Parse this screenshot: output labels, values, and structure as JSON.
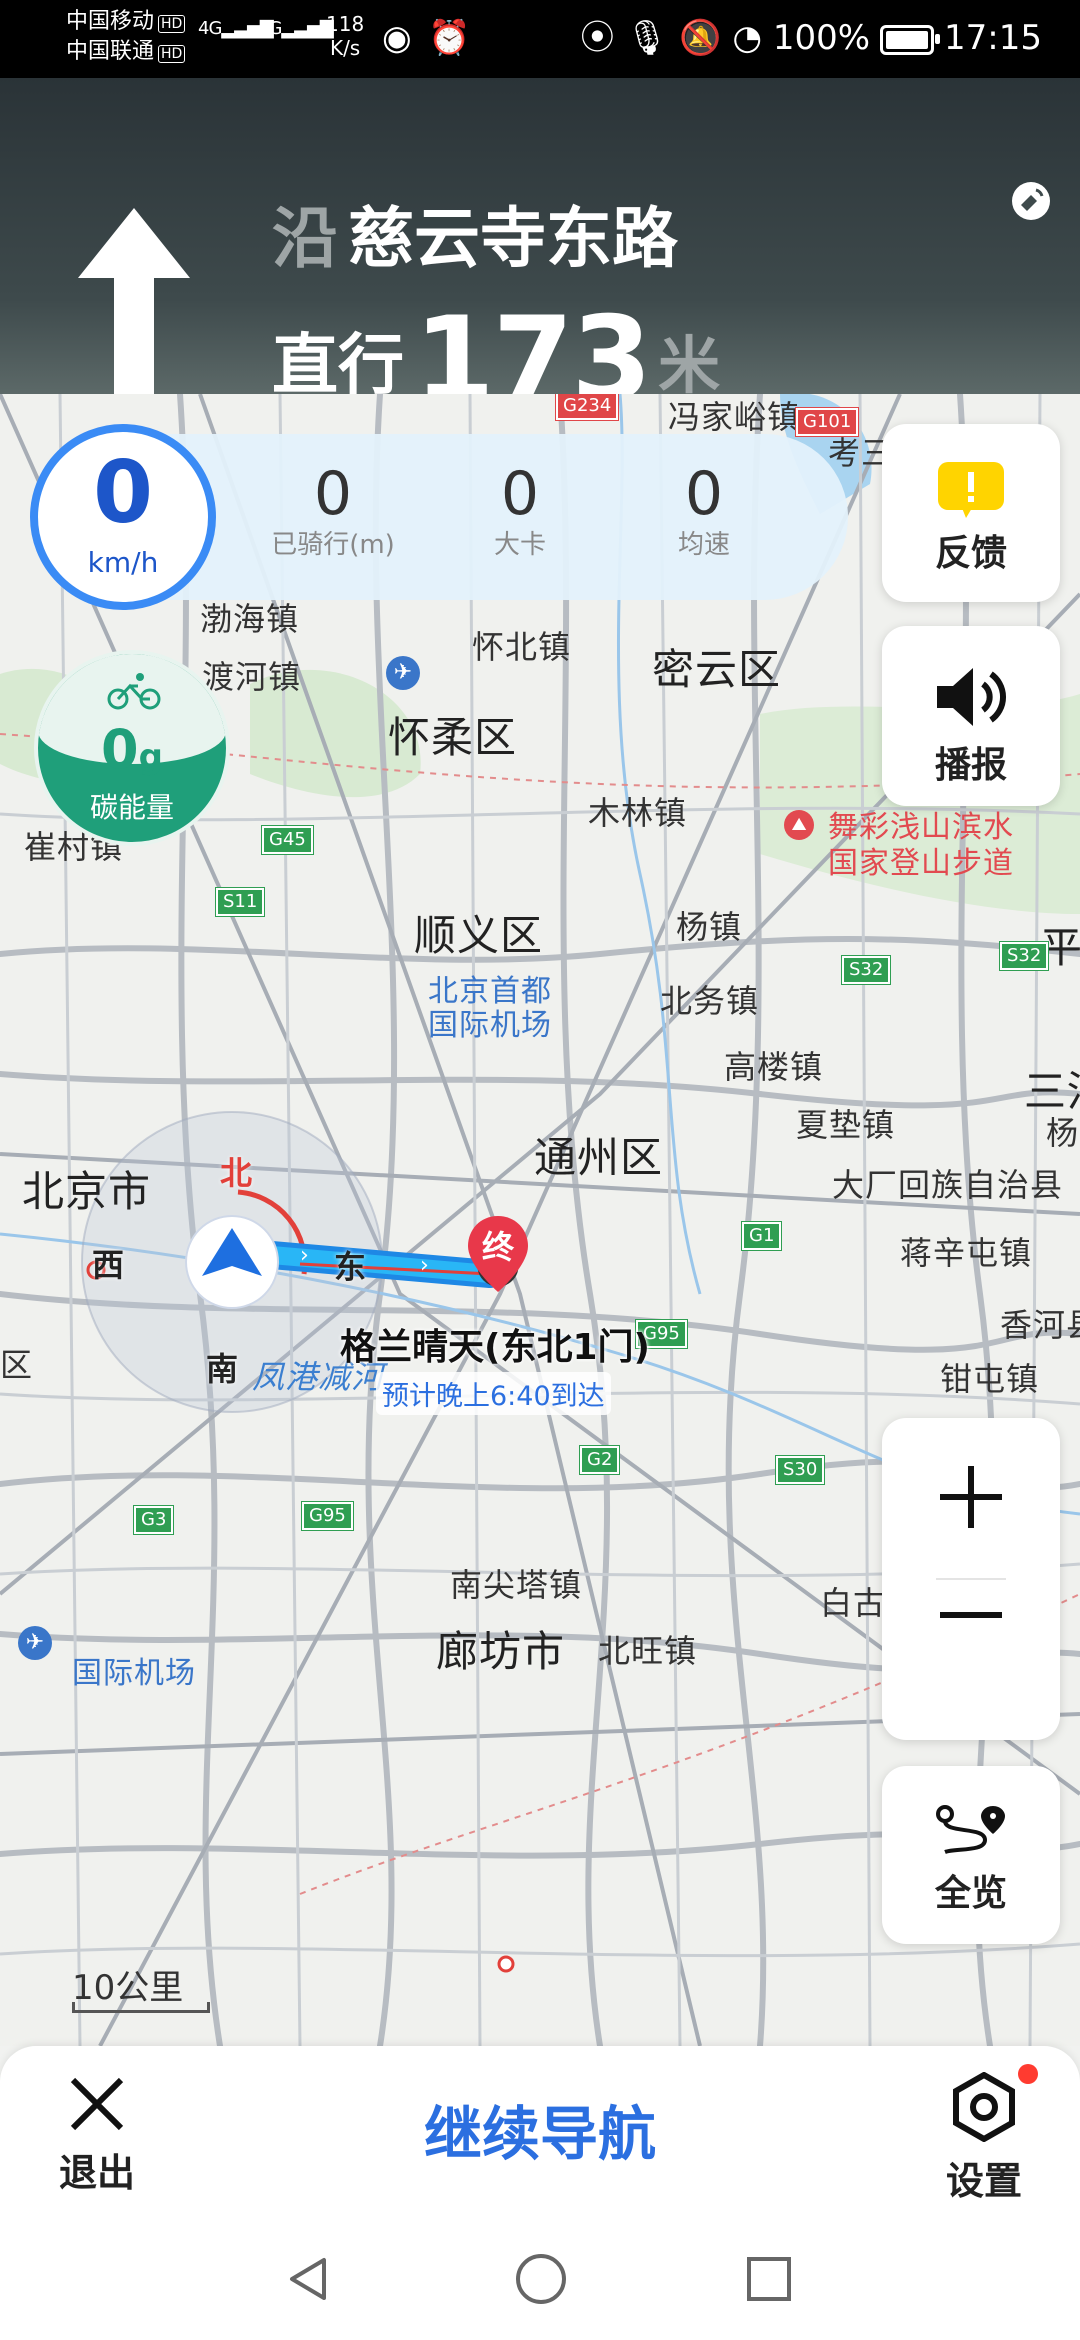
{
  "status_bar": {
    "carrier1": "中国移动",
    "carrier2": "中国联通",
    "hd": "HD",
    "signal1": "4G",
    "signal2": "4G",
    "net_speed_value": "118",
    "net_speed_unit": "K/s",
    "battery": "100%",
    "time": "17:15"
  },
  "nav_header": {
    "along": "沿",
    "street": "慈云寺东路",
    "action": "直行",
    "distance": "173",
    "unit": "米"
  },
  "speed_panel": {
    "speed": "0",
    "speed_unit": "km/h",
    "stats": [
      {
        "value": "0",
        "label": "已骑行(m)"
      },
      {
        "value": "0",
        "label": "大卡"
      },
      {
        "value": "0",
        "label": "均速"
      }
    ]
  },
  "carbon": {
    "value": "0",
    "unit": "g",
    "label": "碳能量"
  },
  "side_buttons": {
    "feedback": "反馈",
    "broadcast": "播报",
    "overview": "全览"
  },
  "map": {
    "labels": {
      "fengjiayu": "冯家峪镇",
      "kaoshan": "考三",
      "bohai": "渤海镇",
      "huaibei": "怀北镇",
      "miyun": "密云区",
      "duhe": "渡河镇",
      "huairou": "怀柔区",
      "mulin": "木林镇",
      "cuicun": "崔村镇",
      "wucai1": "舞彩浅山滨水",
      "wucai2": "国家登山步道",
      "ping": "平",
      "shunyi": "顺义区",
      "yangzhen": "杨镇",
      "airport1": "北京首都",
      "airport2": "国际机场",
      "beiwu": "北务镇",
      "gaolou": "高楼镇",
      "sanhe": "三河",
      "xiadian": "夏垫镇",
      "yang": "杨",
      "tongzhou": "通州区",
      "beijing": "北京市",
      "dachang": "大厂回族自治县",
      "xiangji": "蒋辛屯镇",
      "xianghe": "香河县",
      "qu": "区",
      "fenggang": "凤港减河",
      "qianzhen": "钳屯镇",
      "nanjian": "南尖塔镇",
      "baigu": "白古屯镇",
      "langfang": "廊坊市",
      "beiwang": "北旺镇",
      "daxing_airport": "国际机场"
    },
    "highways": [
      "G234",
      "G101",
      "G45",
      "S11",
      "S32",
      "S32",
      "G1",
      "G95",
      "G2",
      "S30",
      "G3",
      "G95"
    ],
    "compass": {
      "north": "北",
      "east": "东",
      "south": "南",
      "west": "西"
    },
    "destination": "格兰晴天(东北1门)",
    "end_marker": "终",
    "eta": "预计晚上6:40到达",
    "scale": "10公里"
  },
  "bottom_bar": {
    "exit": "退出",
    "continue": "继续导航",
    "settings": "设置"
  },
  "colors": {
    "accent": "#2b6fe0",
    "route": "#29b6f6",
    "carbon": "#1f9f7a",
    "feedback": "#ffd400",
    "notification_dot": "#ff3b30"
  }
}
